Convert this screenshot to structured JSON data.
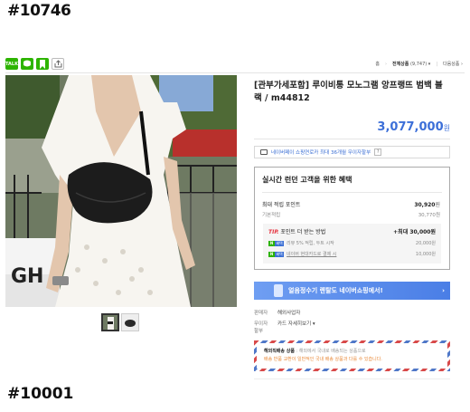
{
  "post": {
    "title": "#10746",
    "footer": "#10001"
  },
  "toolbar": {
    "icons": [
      "talk-icon",
      "blog-icon",
      "band-icon",
      "share-icon"
    ],
    "talk_label": "TALK"
  },
  "category_bar": {
    "home": "홈",
    "all_products": "전체상품",
    "count": "(9,747)",
    "next": "다음상품",
    "arrow": "▾",
    "next_arrow": "›"
  },
  "product": {
    "name": "[관부가세포함] 루이비통 모노그램 앙프랭뜨 범백 블랙 / m44812",
    "price": "3,077,000",
    "currency": "원",
    "photo_sign": "GH"
  },
  "npay": {
    "text": "네이버페이 쇼핑연로카 최대 36개월 무이자할부",
    "help": "?"
  },
  "benefit": {
    "title": "실시간 런던 고객을 위한 혜택",
    "max_points_label": "최대 적립 포인트",
    "max_points_value": "30,920",
    "base_label": "기본적립",
    "base_value": "30,770",
    "unit": "원",
    "tip_label": "TIP.",
    "tip_text": "포인트 더 받는 방법",
    "tip_max": "+최대 30,000",
    "tip_rows": [
      {
        "text": "리뷰 5% 적립, 두트 시작",
        "value": "20,000원"
      },
      {
        "text": "네이버 현대카드로 결제 시",
        "value": "10,000원"
      }
    ],
    "badge_n": "N",
    "badge_p": "혜택"
  },
  "banner": {
    "text": "얼음정수기 렌탈도 네이버쇼핑에서!",
    "arrow": "›"
  },
  "meta": [
    {
      "key": "판매자",
      "value": "해외사업자"
    },
    {
      "key": "무이자할부",
      "value": "카드 자세히보기 ▾"
    }
  ],
  "overseas": {
    "title": "해외직배송 상품",
    "line1": "해외에서 국내로 배송되는 상품으로",
    "line2": "배송 반품 교환이 일반적인 국내 배송 상품과 다를 수 있습니다."
  },
  "colors": {
    "price_blue": "#3c6fd8",
    "naver_green": "#2db400",
    "tip_red": "#e5323e",
    "banner_blue": "#5a8aec"
  }
}
